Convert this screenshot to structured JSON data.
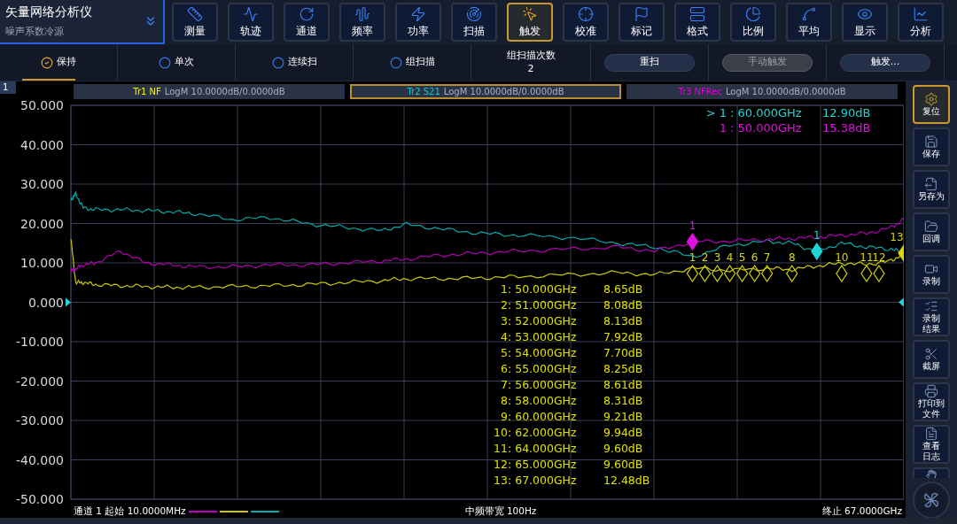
{
  "header": {
    "title": "矢量网络分析仪",
    "subtitle": "噪声系数冷源"
  },
  "menu": [
    {
      "label": "测量",
      "selected": false
    },
    {
      "label": "轨迹",
      "selected": false
    },
    {
      "label": "通道",
      "selected": false
    },
    {
      "label": "频率",
      "selected": false
    },
    {
      "label": "功率",
      "selected": false
    },
    {
      "label": "扫描",
      "selected": false
    },
    {
      "label": "触发",
      "selected": true
    },
    {
      "label": "校准",
      "selected": false
    },
    {
      "label": "标记",
      "selected": false
    },
    {
      "label": "格式",
      "selected": false
    },
    {
      "label": "比例",
      "selected": false
    },
    {
      "label": "平均",
      "selected": false
    },
    {
      "label": "显示",
      "selected": false
    },
    {
      "label": "分析",
      "selected": false
    }
  ],
  "toolbar": {
    "modes": [
      {
        "label": "保持",
        "selected": true
      },
      {
        "label": "单次",
        "selected": false
      },
      {
        "label": "连续扫",
        "selected": false
      },
      {
        "label": "组扫描",
        "selected": false
      }
    ],
    "count": {
      "label": "组扫描次数",
      "value": "2"
    },
    "buttons": [
      {
        "label": "重扫",
        "disabled": false
      },
      {
        "label": "手动触发",
        "disabled": true
      },
      {
        "label": "触发...",
        "disabled": false
      }
    ]
  },
  "channel": "1",
  "traces": [
    {
      "name": "Tr1 NF",
      "format": "LogM 10.0000dB/0.0000dB",
      "selected": false,
      "color": "#c8c800"
    },
    {
      "name": "Tr2 S21",
      "format": "LogM 10.0000dB/0.0000dB",
      "selected": true,
      "color": "#00a8a8"
    },
    {
      "name": "Tr3 NFRec",
      "format": "LogM 10.0000dB/0.0000dB",
      "selected": false,
      "color": "#b000b0"
    }
  ],
  "y_axis": {
    "labels": [
      "50.000",
      "40.000",
      "30.000",
      "20.000",
      "10.000",
      "0.000",
      "-10.000",
      "-20.000",
      "-30.000",
      "-40.000",
      "-50.000"
    ]
  },
  "active_markers": [
    {
      "label": "> 1",
      "stimulus": ": 60.000GHz",
      "value": "12.90dB",
      "color": "#22d3d3"
    },
    {
      "label": "1",
      "stimulus": ": 50.000GHz",
      "value": "15.38dB",
      "color": "#e010e0"
    }
  ],
  "plot_markers": [
    {
      "text": "1",
      "color": "#e010e0",
      "filled": true
    },
    {
      "text": "1",
      "color": "#22d3d3",
      "filled": true
    },
    {
      "text": "1",
      "color": "#d8d800",
      "filled": false
    },
    {
      "text": "2",
      "color": "#d8d800",
      "filled": false
    },
    {
      "text": "3",
      "color": "#d8d800",
      "filled": false
    },
    {
      "text": "4",
      "color": "#d8d800",
      "filled": false
    },
    {
      "text": "5",
      "color": "#d8d800",
      "filled": false
    },
    {
      "text": "6",
      "color": "#d8d800",
      "filled": false
    },
    {
      "text": "7",
      "color": "#d8d800",
      "filled": false
    },
    {
      "text": "8",
      "color": "#d8d800",
      "filled": false
    },
    {
      "text": "10",
      "color": "#d8d800",
      "filled": false
    },
    {
      "text": "11",
      "color": "#d8d800",
      "filled": false
    },
    {
      "text": "12",
      "color": "#d8d800",
      "filled": false
    },
    {
      "text": "13",
      "color": "#d8d800",
      "filled": true
    }
  ],
  "marker_table": [
    {
      "label": "1",
      "stimulus": ": 50.000GHz",
      "value": "8.65dB"
    },
    {
      "label": "2",
      "stimulus": ": 51.000GHz",
      "value": "8.08dB"
    },
    {
      "label": "3",
      "stimulus": ": 52.000GHz",
      "value": "8.13dB"
    },
    {
      "label": "4",
      "stimulus": ": 53.000GHz",
      "value": "7.92dB"
    },
    {
      "label": "5",
      "stimulus": ": 54.000GHz",
      "value": "7.70dB"
    },
    {
      "label": "6",
      "stimulus": ": 55.000GHz",
      "value": "8.25dB"
    },
    {
      "label": "7",
      "stimulus": ": 56.000GHz",
      "value": "8.61dB"
    },
    {
      "label": "8",
      "stimulus": ": 58.000GHz",
      "value": "8.31dB"
    },
    {
      "label": "9",
      "stimulus": ": 60.000GHz",
      "value": "9.21dB"
    },
    {
      "label": "10",
      "stimulus": ": 62.000GHz",
      "value": "9.94dB"
    },
    {
      "label": "11",
      "stimulus": ": 64.000GHz",
      "value": "9.60dB"
    },
    {
      "label": "12",
      "stimulus": ": 65.000GHz",
      "value": "9.60dB"
    },
    {
      "label": "13",
      "stimulus": ": 67.000GHz",
      "value": "12.48dB"
    }
  ],
  "status": {
    "start": "通道 1 起始 10.0000MHz",
    "legend": [
      {
        "color": "#c000c0"
      },
      {
        "color": "#c8c800"
      },
      {
        "color": "#00b0b0"
      }
    ],
    "bandwidth": "中频带宽 100Hz",
    "stop": "终止 67.0000GHz"
  },
  "side_buttons": [
    {
      "label": "复位",
      "selected": true
    },
    {
      "label": "保存",
      "selected": false
    },
    {
      "label": "另存为",
      "selected": false
    },
    {
      "label": "回调",
      "selected": false
    },
    {
      "label": "录制",
      "selected": false
    },
    {
      "label": "录制结果",
      "selected": false
    },
    {
      "label": "截屏",
      "selected": false
    },
    {
      "label": "打印到文件",
      "selected": false
    },
    {
      "label": "查看日志",
      "selected": false
    }
  ]
}
